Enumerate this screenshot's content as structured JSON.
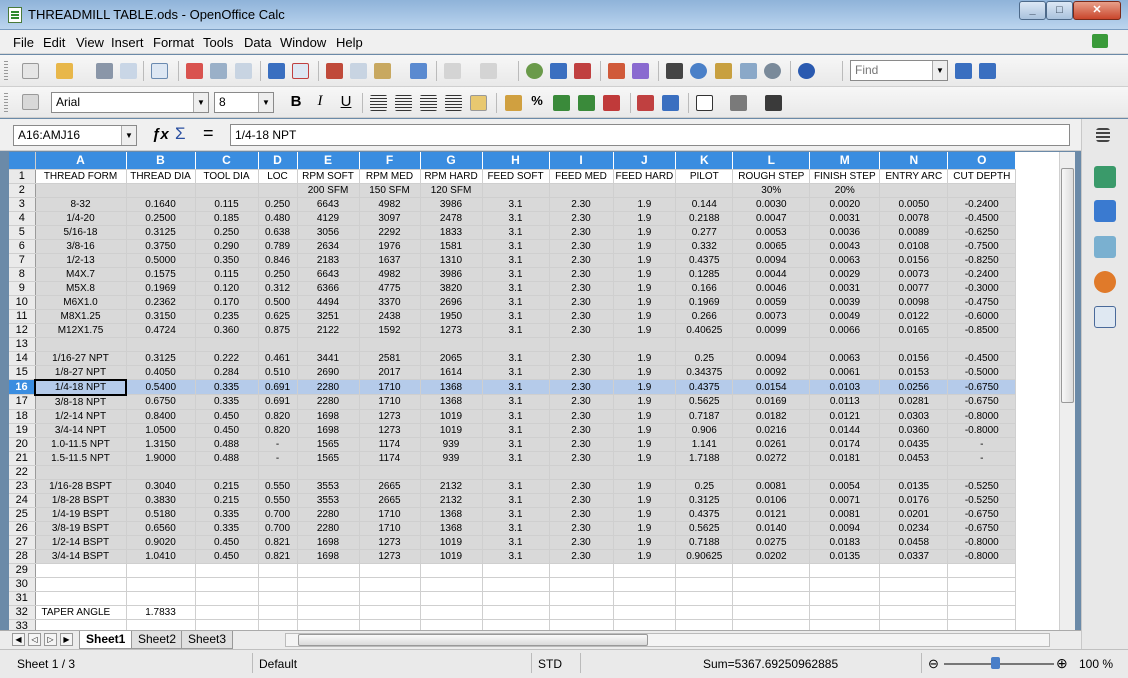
{
  "window": {
    "title": "THREADMILL TABLE.ods - OpenOffice Calc",
    "min": "_",
    "max": "□",
    "close": "✕"
  },
  "menu": [
    "File",
    "Edit",
    "View",
    "Insert",
    "Format",
    "Tools",
    "Data",
    "Window",
    "Help"
  ],
  "toolbar": {
    "find_placeholder": "Find"
  },
  "format_bar": {
    "font_name": "Arial",
    "font_size": "8",
    "bold": "B",
    "italic": "I",
    "underline": "U",
    "percent": "%"
  },
  "formula_bar": {
    "name_box": "A16:AMJ16",
    "formula": "1/4-18 NPT"
  },
  "columns": [
    "A",
    "B",
    "C",
    "D",
    "E",
    "F",
    "G",
    "H",
    "I",
    "J",
    "K",
    "L",
    "M",
    "N",
    "O"
  ],
  "rows": [
    {
      "n": "1",
      "c": [
        "THREAD FORM",
        "THREAD DIA",
        "TOOL DIA",
        "LOC",
        "RPM SOFT",
        "RPM MED",
        "RPM HARD",
        "FEED SOFT",
        "FEED MED",
        "FEED HARD",
        "PILOT",
        "ROUGH STEP",
        "FINISH STEP",
        "ENTRY ARC",
        "CUT DEPTH"
      ]
    },
    {
      "n": "2",
      "c": [
        "",
        "",
        "",
        "",
        "200 SFM",
        "150 SFM",
        "120 SFM",
        "",
        "",
        "",
        "",
        "30%",
        "20%",
        "",
        ""
      ]
    },
    {
      "n": "3",
      "c": [
        "8-32",
        "0.1640",
        "0.115",
        "0.250",
        "6643",
        "4982",
        "3986",
        "3.1",
        "2.30",
        "1.9",
        "0.144",
        "0.0030",
        "0.0020",
        "0.0050",
        "-0.2400"
      ]
    },
    {
      "n": "4",
      "c": [
        "1/4-20",
        "0.2500",
        "0.185",
        "0.480",
        "4129",
        "3097",
        "2478",
        "3.1",
        "2.30",
        "1.9",
        "0.2188",
        "0.0047",
        "0.0031",
        "0.0078",
        "-0.4500"
      ]
    },
    {
      "n": "5",
      "c": [
        "5/16-18",
        "0.3125",
        "0.250",
        "0.638",
        "3056",
        "2292",
        "1833",
        "3.1",
        "2.30",
        "1.9",
        "0.277",
        "0.0053",
        "0.0036",
        "0.0089",
        "-0.6250"
      ]
    },
    {
      "n": "6",
      "c": [
        "3/8-16",
        "0.3750",
        "0.290",
        "0.789",
        "2634",
        "1976",
        "1581",
        "3.1",
        "2.30",
        "1.9",
        "0.332",
        "0.0065",
        "0.0043",
        "0.0108",
        "-0.7500"
      ]
    },
    {
      "n": "7",
      "c": [
        "1/2-13",
        "0.5000",
        "0.350",
        "0.846",
        "2183",
        "1637",
        "1310",
        "3.1",
        "2.30",
        "1.9",
        "0.4375",
        "0.0094",
        "0.0063",
        "0.0156",
        "-0.8250"
      ]
    },
    {
      "n": "8",
      "c": [
        "M4X.7",
        "0.1575",
        "0.115",
        "0.250",
        "6643",
        "4982",
        "3986",
        "3.1",
        "2.30",
        "1.9",
        "0.1285",
        "0.0044",
        "0.0029",
        "0.0073",
        "-0.2400"
      ]
    },
    {
      "n": "9",
      "c": [
        "M5X.8",
        "0.1969",
        "0.120",
        "0.312",
        "6366",
        "4775",
        "3820",
        "3.1",
        "2.30",
        "1.9",
        "0.166",
        "0.0046",
        "0.0031",
        "0.0077",
        "-0.3000"
      ]
    },
    {
      "n": "10",
      "c": [
        "M6X1.0",
        "0.2362",
        "0.170",
        "0.500",
        "4494",
        "3370",
        "2696",
        "3.1",
        "2.30",
        "1.9",
        "0.1969",
        "0.0059",
        "0.0039",
        "0.0098",
        "-0.4750"
      ]
    },
    {
      "n": "11",
      "c": [
        "M8X1.25",
        "0.3150",
        "0.235",
        "0.625",
        "3251",
        "2438",
        "1950",
        "3.1",
        "2.30",
        "1.9",
        "0.266",
        "0.0073",
        "0.0049",
        "0.0122",
        "-0.6000"
      ]
    },
    {
      "n": "12",
      "c": [
        "M12X1.75",
        "0.4724",
        "0.360",
        "0.875",
        "2122",
        "1592",
        "1273",
        "3.1",
        "2.30",
        "1.9",
        "0.40625",
        "0.0099",
        "0.0066",
        "0.0165",
        "-0.8500"
      ]
    },
    {
      "n": "13",
      "c": [
        "",
        "",
        "",
        "",
        "",
        "",
        "",
        "",
        "",
        "",
        "",
        "",
        "",
        "",
        ""
      ]
    },
    {
      "n": "14",
      "c": [
        "1/16-27 NPT",
        "0.3125",
        "0.222",
        "0.461",
        "3441",
        "2581",
        "2065",
        "3.1",
        "2.30",
        "1.9",
        "0.25",
        "0.0094",
        "0.0063",
        "0.0156",
        "-0.4500"
      ]
    },
    {
      "n": "15",
      "c": [
        "1/8-27 NPT",
        "0.4050",
        "0.284",
        "0.510",
        "2690",
        "2017",
        "1614",
        "3.1",
        "2.30",
        "1.9",
        "0.34375",
        "0.0092",
        "0.0061",
        "0.0153",
        "-0.5000"
      ]
    },
    {
      "n": "16",
      "c": [
        "1/4-18 NPT",
        "0.5400",
        "0.335",
        "0.691",
        "2280",
        "1710",
        "1368",
        "3.1",
        "2.30",
        "1.9",
        "0.4375",
        "0.0154",
        "0.0103",
        "0.0256",
        "-0.6750"
      ]
    },
    {
      "n": "17",
      "c": [
        "3/8-18 NPT",
        "0.6750",
        "0.335",
        "0.691",
        "2280",
        "1710",
        "1368",
        "3.1",
        "2.30",
        "1.9",
        "0.5625",
        "0.0169",
        "0.0113",
        "0.0281",
        "-0.6750"
      ]
    },
    {
      "n": "18",
      "c": [
        "1/2-14 NPT",
        "0.8400",
        "0.450",
        "0.820",
        "1698",
        "1273",
        "1019",
        "3.1",
        "2.30",
        "1.9",
        "0.7187",
        "0.0182",
        "0.0121",
        "0.0303",
        "-0.8000"
      ]
    },
    {
      "n": "19",
      "c": [
        "3/4-14 NPT",
        "1.0500",
        "0.450",
        "0.820",
        "1698",
        "1273",
        "1019",
        "3.1",
        "2.30",
        "1.9",
        "0.906",
        "0.0216",
        "0.0144",
        "0.0360",
        "-0.8000"
      ]
    },
    {
      "n": "20",
      "c": [
        "1.0-11.5 NPT",
        "1.3150",
        "0.488",
        "-",
        "1565",
        "1174",
        "939",
        "3.1",
        "2.30",
        "1.9",
        "1.141",
        "0.0261",
        "0.0174",
        "0.0435",
        "-"
      ]
    },
    {
      "n": "21",
      "c": [
        "1.5-11.5 NPT",
        "1.9000",
        "0.488",
        "-",
        "1565",
        "1174",
        "939",
        "3.1",
        "2.30",
        "1.9",
        "1.7188",
        "0.0272",
        "0.0181",
        "0.0453",
        "-"
      ]
    },
    {
      "n": "22",
      "c": [
        "",
        "",
        "",
        "",
        "",
        "",
        "",
        "",
        "",
        "",
        "",
        "",
        "",
        "",
        ""
      ]
    },
    {
      "n": "23",
      "c": [
        "1/16-28 BSPT",
        "0.3040",
        "0.215",
        "0.550",
        "3553",
        "2665",
        "2132",
        "3.1",
        "2.30",
        "1.9",
        "0.25",
        "0.0081",
        "0.0054",
        "0.0135",
        "-0.5250"
      ]
    },
    {
      "n": "24",
      "c": [
        "1/8-28 BSPT",
        "0.3830",
        "0.215",
        "0.550",
        "3553",
        "2665",
        "2132",
        "3.1",
        "2.30",
        "1.9",
        "0.3125",
        "0.0106",
        "0.0071",
        "0.0176",
        "-0.5250"
      ]
    },
    {
      "n": "25",
      "c": [
        "1/4-19 BSPT",
        "0.5180",
        "0.335",
        "0.700",
        "2280",
        "1710",
        "1368",
        "3.1",
        "2.30",
        "1.9",
        "0.4375",
        "0.0121",
        "0.0081",
        "0.0201",
        "-0.6750"
      ]
    },
    {
      "n": "26",
      "c": [
        "3/8-19 BSPT",
        "0.6560",
        "0.335",
        "0.700",
        "2280",
        "1710",
        "1368",
        "3.1",
        "2.30",
        "1.9",
        "0.5625",
        "0.0140",
        "0.0094",
        "0.0234",
        "-0.6750"
      ]
    },
    {
      "n": "27",
      "c": [
        "1/2-14 BSPT",
        "0.9020",
        "0.450",
        "0.821",
        "1698",
        "1273",
        "1019",
        "3.1",
        "2.30",
        "1.9",
        "0.7188",
        "0.0275",
        "0.0183",
        "0.0458",
        "-0.8000"
      ]
    },
    {
      "n": "28",
      "c": [
        "3/4-14 BSPT",
        "1.0410",
        "0.450",
        "0.821",
        "1698",
        "1273",
        "1019",
        "3.1",
        "2.30",
        "1.9",
        "0.90625",
        "0.0202",
        "0.0135",
        "0.0337",
        "-0.8000"
      ]
    },
    {
      "n": "29",
      "c": [
        "",
        "",
        "",
        "",
        "",
        "",
        "",
        "",
        "",
        "",
        "",
        "",
        "",
        "",
        ""
      ]
    },
    {
      "n": "30",
      "c": [
        "",
        "",
        "",
        "",
        "",
        "",
        "",
        "",
        "",
        "",
        "",
        "",
        "",
        "",
        ""
      ]
    },
    {
      "n": "31",
      "c": [
        "",
        "",
        "",
        "",
        "",
        "",
        "",
        "",
        "",
        "",
        "",
        "",
        "",
        "",
        ""
      ]
    },
    {
      "n": "32",
      "c": [
        "TAPER ANGLE",
        "1.7833",
        "",
        "",
        "",
        "",
        "",
        "",
        "",
        "",
        "",
        "",
        "",
        "",
        ""
      ]
    },
    {
      "n": "33",
      "c": [
        "",
        "",
        "",
        "",
        "",
        "",
        "",
        "",
        "",
        "",
        "",
        "",
        "",
        "",
        ""
      ]
    }
  ],
  "shaded_rows": [
    "2",
    "3",
    "4",
    "5",
    "6",
    "7",
    "8",
    "9",
    "10",
    "11",
    "12",
    "13",
    "14",
    "15",
    "17",
    "18",
    "19",
    "20",
    "21",
    "22",
    "23",
    "24",
    "25",
    "26",
    "27",
    "28"
  ],
  "selected_row": "16",
  "sheets": [
    "Sheet1",
    "Sheet2",
    "Sheet3"
  ],
  "active_sheet": "Sheet1",
  "status": {
    "sheet": "Sheet 1 / 3",
    "style": "Default",
    "mode": "STD",
    "sum": "Sum=5367.69250962885",
    "zoom": "100 %"
  },
  "colors": {
    "accent": "#3a8de0",
    "selection": "#b5cbea",
    "shade": "#d9d9d9"
  }
}
